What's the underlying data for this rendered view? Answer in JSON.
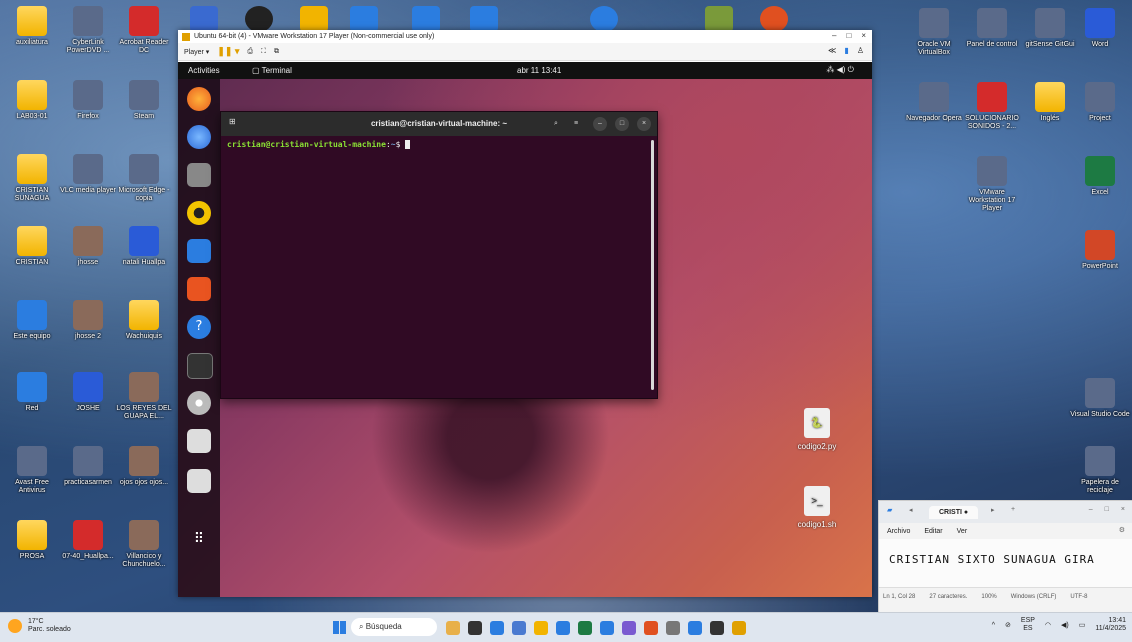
{
  "desktop_left": [
    {
      "label": "auxiliatura",
      "type": "folder"
    },
    {
      "label": "CyberLink PowerDVD ...",
      "type": "app"
    },
    {
      "label": "Acrobat Reader DC",
      "type": "pdf"
    },
    {
      "label": "LAB03-01",
      "type": "folder"
    },
    {
      "label": "Firefox",
      "type": "app"
    },
    {
      "label": "Steam",
      "type": "app"
    },
    {
      "label": "CRISTIAN SUNAGUA",
      "type": "folder"
    },
    {
      "label": "VLC media player",
      "type": "app"
    },
    {
      "label": "Microsoft Edge - copia",
      "type": "app"
    },
    {
      "label": "CRISTIAN",
      "type": "folder"
    },
    {
      "label": "jhosse",
      "type": "image"
    },
    {
      "label": "natali Huallpa",
      "type": "word"
    },
    {
      "label": "Este equipo",
      "type": "pc"
    },
    {
      "label": "jhosse 2",
      "type": "image"
    },
    {
      "label": "Wachuiquis",
      "type": "folder"
    },
    {
      "label": "Red",
      "type": "net"
    },
    {
      "label": "JOSHE",
      "type": "word"
    },
    {
      "label": "LOS REYES DEL GUAPA EL...",
      "type": "image"
    },
    {
      "label": "Avast Free Antivirus",
      "type": "app"
    },
    {
      "label": "practicasarmen",
      "type": "app"
    },
    {
      "label": "ojos ojos ojos...",
      "type": "image"
    },
    {
      "label": "PROSA",
      "type": "folder"
    },
    {
      "label": "07-40_Huallpa...",
      "type": "pdf"
    },
    {
      "label": "Villancico y Chunchuelo...",
      "type": "image"
    }
  ],
  "desktop_right": [
    {
      "label": "Oracle VM VirtualBox",
      "type": "app"
    },
    {
      "label": "Panel de control",
      "type": "app"
    },
    {
      "label": "gitSense GitGui",
      "type": "app"
    },
    {
      "label": "Word",
      "type": "word"
    },
    {
      "label": "Navegador Opera",
      "type": "app"
    },
    {
      "label": "SOLUCIONARIO SONIDOS - 2...",
      "type": "pdf"
    },
    {
      "label": "Inglés",
      "type": "folder"
    },
    {
      "label": "Project",
      "type": "app"
    },
    {
      "label": "VMware Workstation 17 Player",
      "type": "app"
    },
    {
      "label": "Excel",
      "type": "excel"
    },
    {
      "label": "PowerPoint",
      "type": "ppt"
    },
    {
      "label": "Visual Studio Code",
      "type": "app"
    },
    {
      "label": "Papelera de reciclaje",
      "type": "app"
    }
  ],
  "vmware": {
    "title": "Ubuntu 64-bit (4) - VMware Workstation 17 Player (Non-commercial use only)",
    "player_menu": "Player ▾",
    "controls": [
      "–",
      "□",
      "×"
    ]
  },
  "gnome": {
    "activities": "Activities",
    "app": "Terminal",
    "clock": "abr 11  13:41",
    "system": "⁂ ◀) ⏻"
  },
  "terminal": {
    "title": "cristian@cristian-virtual-machine: ~",
    "prompt_user": "cristian@cristian-virtual-machine",
    "prompt_sep": ":",
    "prompt_path": "~",
    "prompt_sym": "$"
  },
  "guest_files": [
    {
      "name": "codigo2.py"
    },
    {
      "name": "codigo1.sh"
    }
  ],
  "notepad": {
    "tab": "CRISTI",
    "menu": [
      "Archivo",
      "Editar",
      "Ver"
    ],
    "content": "CRISTIAN  SIXTO  SUNAGUA  GIRA",
    "status": [
      "Ln 1, Col 28",
      "27 caracteres.",
      "100%",
      "Windows (CRLF)",
      "UTF-8"
    ]
  },
  "taskbar": {
    "weather_temp": "17°C",
    "weather_desc": "Parc. soleado",
    "search_placeholder": "Búsqueda",
    "lang1": "ESP",
    "lang2": "ES",
    "time": "13:41",
    "date": "11/4/2025"
  }
}
